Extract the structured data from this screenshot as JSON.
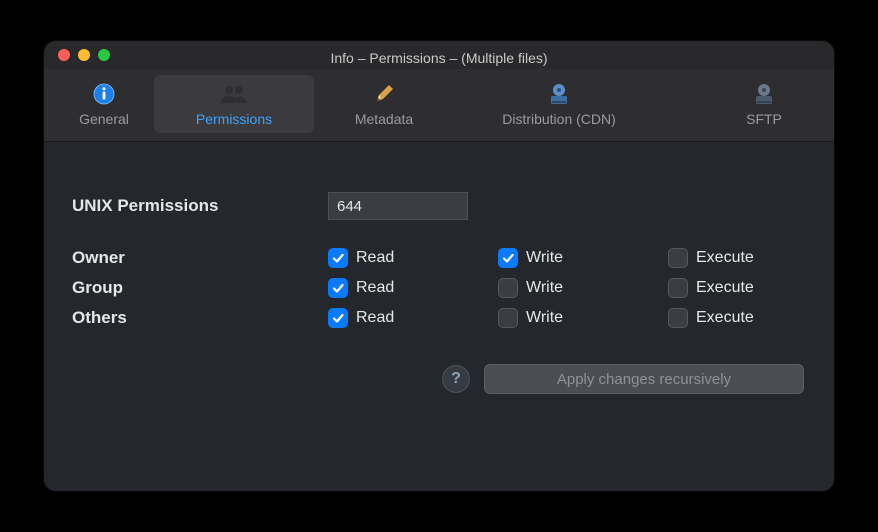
{
  "window": {
    "title": "Info – Permissions – (Multiple files)"
  },
  "tabs": {
    "general": "General",
    "permissions": "Permissions",
    "metadata": "Metadata",
    "distribution": "Distribution (CDN)",
    "sftp": "SFTP"
  },
  "content": {
    "unix_label": "UNIX Permissions",
    "unix_value": "644",
    "roles": {
      "owner": "Owner",
      "group": "Group",
      "others": "Others"
    },
    "perm_labels": {
      "read": "Read",
      "write": "Write",
      "execute": "Execute"
    }
  },
  "footer": {
    "help": "?",
    "apply": "Apply changes recursively"
  }
}
